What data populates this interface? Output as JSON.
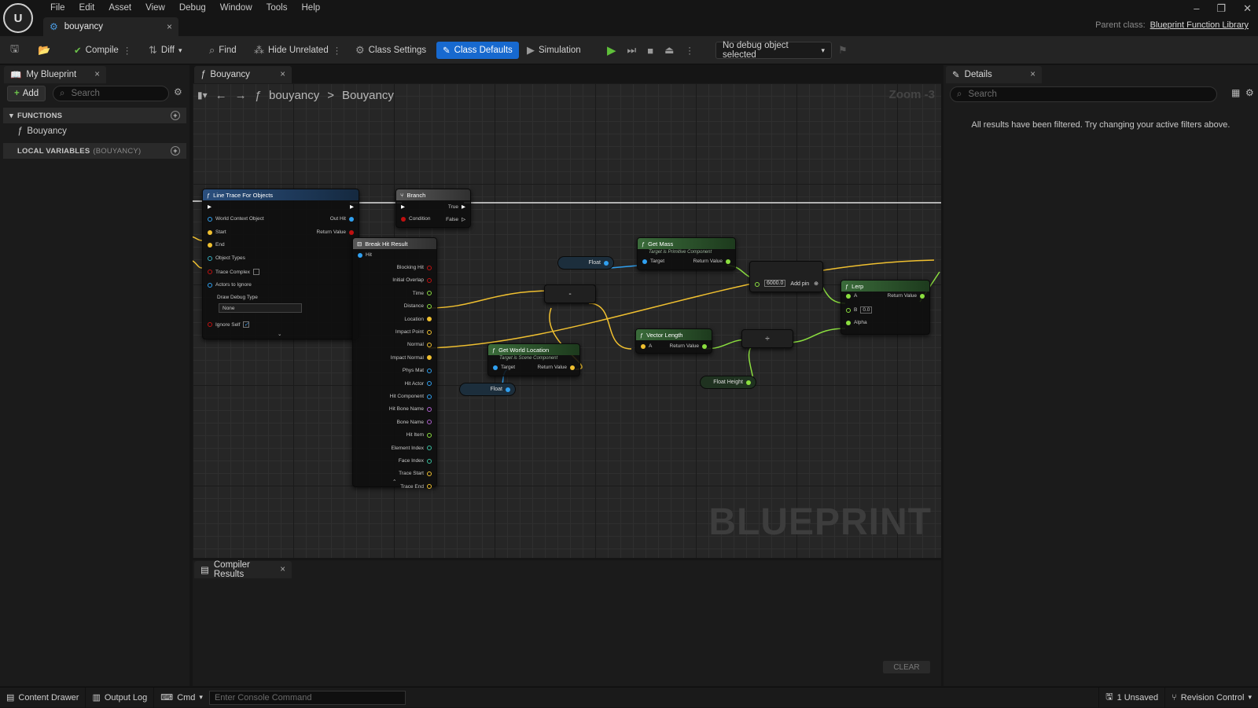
{
  "menu": {
    "items": [
      "File",
      "Edit",
      "Asset",
      "View",
      "Debug",
      "Window",
      "Tools",
      "Help"
    ]
  },
  "document_tab": {
    "title": "bouyancy"
  },
  "parent_class": {
    "label": "Parent class:",
    "value": "Blueprint Function Library"
  },
  "toolbar": {
    "compile": "Compile",
    "diff": "Diff",
    "find": "Find",
    "hide_unrelated": "Hide Unrelated",
    "class_settings": "Class Settings",
    "class_defaults": "Class Defaults",
    "simulation": "Simulation",
    "debug_object": "No debug object selected"
  },
  "my_blueprint": {
    "tab": "My Blueprint",
    "add": "Add",
    "search_placeholder": "Search",
    "functions_header": "FUNCTIONS",
    "function_item": "Bouyancy",
    "local_vars_header": "LOCAL VARIABLES",
    "local_vars_scope": "(BOUYANCY)"
  },
  "graph_tab": {
    "title": "Bouyancy"
  },
  "breadcrumb": {
    "root": "bouyancy",
    "sep": ">",
    "current": "Bouyancy"
  },
  "graph": {
    "zoom": "Zoom -3",
    "watermark": "BLUEPRINT",
    "line_trace": {
      "title": "Line Trace For Objects",
      "pins_left": [
        "World Context Object",
        "Start",
        "End",
        "Object Types",
        "Trace Complex",
        "Actors to Ignore",
        "Draw Debug Type",
        "Ignore Self"
      ],
      "debug_value": "None",
      "out_hit": "Out Hit",
      "return_value": "Return Value"
    },
    "branch": {
      "title": "Branch",
      "condition": "Condition",
      "true": "True",
      "false": "False"
    },
    "break_hit": {
      "title": "Break Hit Result",
      "hit": "Hit",
      "outputs": [
        "Blocking Hit",
        "Initial Overlap",
        "Time",
        "Distance",
        "Location",
        "Impact Point",
        "Normal",
        "Impact Normal",
        "Phys Mat",
        "Hit Actor",
        "Hit Component",
        "Hit Bone Name",
        "Bone Name",
        "Hit Item",
        "Element Index",
        "Face Index",
        "Trace Start",
        "Trace End"
      ]
    },
    "get_mass": {
      "title": "Get Mass",
      "subtitle": "Target is Primitive Component",
      "target": "Target",
      "return": "Return Value"
    },
    "get_world_location": {
      "title": "Get World Location",
      "subtitle": "Target is Scene Component",
      "target": "Target",
      "return": "Return Value"
    },
    "vector_length": {
      "title": "Vector Length",
      "a": "A",
      "return": "Return Value"
    },
    "lerp": {
      "title": "Lerp",
      "a": "A",
      "b": "B",
      "b_value": "0.0",
      "alpha": "Alpha",
      "return": "Return Value"
    },
    "multiply": {
      "value": "6000.0",
      "add_pin": "Add pin"
    },
    "subtract": {
      "symbol": "-"
    },
    "divide": {
      "symbol": "÷"
    },
    "float1": "Float",
    "float2": "Float",
    "float_height": "Float Height"
  },
  "details": {
    "tab": "Details",
    "search_placeholder": "Search",
    "message": "All results have been filtered. Try changing your active filters above."
  },
  "compiler": {
    "tab": "Compiler Results",
    "clear": "CLEAR"
  },
  "statusbar": {
    "content_drawer": "Content Drawer",
    "output_log": "Output Log",
    "cmd": "Cmd",
    "console_placeholder": "Enter Console Command",
    "unsaved": "1 Unsaved",
    "revision": "Revision Control"
  },
  "colors": {
    "accent": "#1769cf",
    "exec": "#ffffff",
    "float": "#8bde3f",
    "vector": "#f0c030",
    "object": "#30a0f0",
    "bool": "#c01010"
  }
}
